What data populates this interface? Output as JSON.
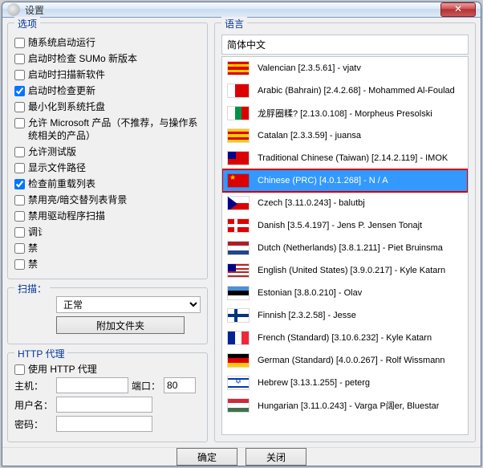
{
  "window": {
    "title": "设置"
  },
  "options": {
    "legend": "选项",
    "items": [
      {
        "label": "随系统启动运行",
        "checked": false
      },
      {
        "label": "启动时检查 SUMo 新版本",
        "checked": false
      },
      {
        "label": "启动时扫描新软件",
        "checked": false
      },
      {
        "label": "启动时检查更新",
        "checked": true
      },
      {
        "label": "最小化到系统托盘",
        "checked": false
      },
      {
        "label": "允许 Microsoft 产品（不推荐，与操作系统相关的产品）",
        "checked": false
      },
      {
        "label": "允许测试版",
        "checked": false
      },
      {
        "label": "显示文件路径",
        "checked": false
      },
      {
        "label": "检查前重载列表",
        "checked": true
      },
      {
        "label": "禁用亮/暗交替列表背景",
        "checked": false
      },
      {
        "label": "禁用驱动程序扫描",
        "checked": false
      },
      {
        "label": "调试",
        "checked": false,
        "obscured": true
      },
      {
        "label": "禁",
        "checked": false,
        "obscured": true
      },
      {
        "label": "禁",
        "checked": false,
        "obscured": true
      }
    ]
  },
  "scan": {
    "legend": "扫描：",
    "mode_label": "正常",
    "add_folder": "附加文件夹"
  },
  "http": {
    "legend": "HTTP 代理",
    "use_proxy": "使用 HTTP 代理",
    "host_label": "主机：",
    "port_label": "端口：",
    "port_value": "80",
    "user_label": "用户名：",
    "pass_label": "密码："
  },
  "lang": {
    "legend": "语言",
    "current": "简体中文",
    "items": [
      {
        "name": "Valencian [2.3.5.61] - vjatv",
        "flag": [
          "#d00",
          "#fc0",
          "#d00",
          "#fc0",
          "#d00"
        ]
      },
      {
        "name": "Arabic (Bahrain) [2.4.2.68] - Mohammed Al-Foulad",
        "flag": [
          "#fff",
          "#d00",
          "#d00"
        ],
        "dir": "h"
      },
      {
        "name": "龙脬圈糅? [2.13.0.108] - Morpheus Presolski",
        "flag": [
          "#fff",
          "#009246",
          "#d00"
        ],
        "dir": "h"
      },
      {
        "name": "Catalan [2.3.3.59] - juansa",
        "flag": [
          "#fc0",
          "#d00",
          "#fc0",
          "#d00",
          "#fc0"
        ]
      },
      {
        "name": "Traditional Chinese (Taiwan) [2.14.2.119] - IMOK",
        "flag": [
          "#d00"
        ],
        "canton": "#00008b"
      },
      {
        "name": "Chinese (PRC) [4.0.1.268] - N / A",
        "flag": [
          "#d00"
        ],
        "star": true,
        "selected": true
      },
      {
        "name": "Czech [3.11.0.243] - balutbj",
        "flag": [
          "#fff",
          "#d00"
        ],
        "tri": "#00008b"
      },
      {
        "name": "Danish [3.5.4.197] - Jens P. Jensen Tonajt",
        "flag": [
          "#d00"
        ],
        "cross": "#fff"
      },
      {
        "name": "Dutch (Netherlands) [3.8.1.211] - Piet Bruinsma",
        "flag": [
          "#ae1c28",
          "#fff",
          "#21468b"
        ]
      },
      {
        "name": "English (United States) [3.9.0.217] - Kyle Katarn",
        "flag": [
          "#b22",
          "#fff",
          "#b22",
          "#fff",
          "#b22",
          "#fff",
          "#b22"
        ],
        "canton": "#00008b"
      },
      {
        "name": "Estonian [3.8.0.210] - Olav",
        "flag": [
          "#4891d9",
          "#000",
          "#fff"
        ]
      },
      {
        "name": "Finnish [2.3.2.58] - Jesse",
        "flag": [
          "#fff"
        ],
        "cross": "#003580"
      },
      {
        "name": "French (Standard) [3.10.6.232] - Kyle Katarn",
        "flag": [
          "#002395",
          "#fff",
          "#ed2939"
        ],
        "dir": "h"
      },
      {
        "name": "German (Standard) [4.0.0.267] - Rolf Wissmann",
        "flag": [
          "#000",
          "#d00",
          "#fc0"
        ]
      },
      {
        "name": "Hebrew [3.13.1.255] - peterg",
        "flag": [
          "#fff"
        ],
        "magen": true
      },
      {
        "name": "Hungarian [3.11.0.243] - Varga P阔er, Bluestar",
        "flag": [
          "#cd2a3e",
          "#fff",
          "#436f4d"
        ]
      }
    ]
  },
  "footer": {
    "ok": "确定",
    "close": "关闭"
  }
}
